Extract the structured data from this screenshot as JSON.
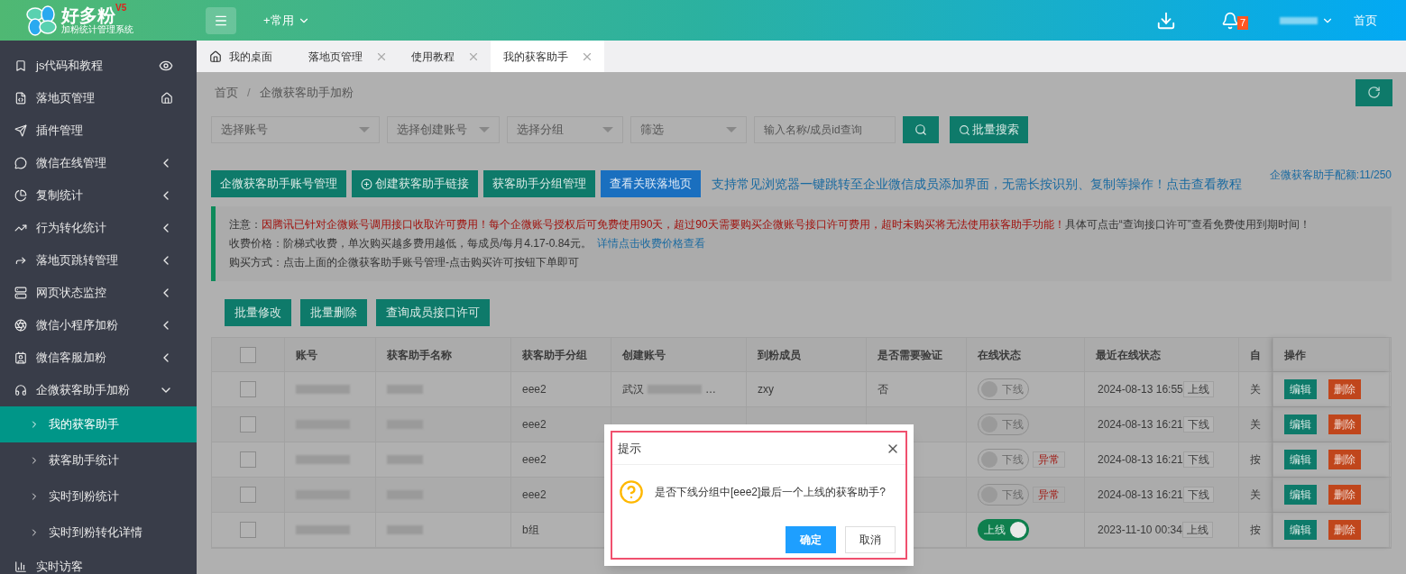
{
  "header": {
    "logo": {
      "title": "好多粉",
      "version": "V5",
      "subtitle": "加粉统计管理系统"
    },
    "quick_menu": "+常用",
    "notification_count": "7",
    "home_link": "首页"
  },
  "sidebar": {
    "items": [
      {
        "label": "js代码和教程",
        "kind": "link",
        "selected": false
      },
      {
        "label": "落地页管理",
        "kind": "link",
        "selected": false
      },
      {
        "label": "插件管理",
        "kind": "link",
        "selected": false
      },
      {
        "label": "微信在线管理",
        "kind": "group",
        "expanded": false,
        "selected": false
      },
      {
        "label": "复制统计",
        "kind": "group",
        "expanded": false,
        "selected": false
      },
      {
        "label": "行为转化统计",
        "kind": "group",
        "expanded": false,
        "selected": false
      },
      {
        "label": "落地页跳转管理",
        "kind": "group",
        "expanded": false,
        "selected": false
      },
      {
        "label": "网页状态监控",
        "kind": "group",
        "expanded": false,
        "selected": false
      },
      {
        "label": "微信小程序加粉",
        "kind": "group",
        "expanded": false,
        "selected": false
      },
      {
        "label": "微信客服加粉",
        "kind": "group",
        "expanded": false,
        "selected": false
      },
      {
        "label": "企微获客助手加粉",
        "kind": "group",
        "expanded": true,
        "selected": false,
        "children": [
          {
            "label": "我的获客助手",
            "selected": true
          },
          {
            "label": "获客助手统计",
            "selected": false
          },
          {
            "label": "实时到粉统计",
            "selected": false
          },
          {
            "label": "实时到粉转化详情",
            "selected": false
          }
        ]
      },
      {
        "label": "实时访客",
        "kind": "link",
        "selected": false
      }
    ]
  },
  "tabs": [
    {
      "label": "我的桌面",
      "kind": "home",
      "selected": false
    },
    {
      "label": "落地页管理",
      "kind": "closable",
      "selected": false
    },
    {
      "label": "使用教程",
      "kind": "closable",
      "selected": false
    },
    {
      "label": "我的获客助手",
      "kind": "closable",
      "selected": true
    }
  ],
  "breadcrumb": {
    "items": [
      "首页",
      "企微获客助手加粉"
    ],
    "separator": "/"
  },
  "filters": {
    "selects": [
      {
        "placeholder": "选择账号"
      },
      {
        "placeholder": "选择创建账号"
      },
      {
        "placeholder": "选择分组"
      },
      {
        "placeholder": "筛选"
      }
    ],
    "search": {
      "placeholder": "输入名称/成员id查询"
    },
    "batch_search": "批量搜索"
  },
  "actions": [
    {
      "label": "企微获客助手账号管理",
      "kind": "primary"
    },
    {
      "label": "创建获客助手链接",
      "kind": "create"
    },
    {
      "label": "获客助手分组管理",
      "kind": "primary"
    },
    {
      "label": "查看关联落地页",
      "kind": "info"
    }
  ],
  "tip_link": "支持常见浏览器一键跳转至企业微信成员添加界面，无需长按识别、复制等操作！点击查看教程",
  "quota": "企微获客助手配额:11/250",
  "notice": [
    {
      "label": "注意：",
      "warning": "因腾讯已针对企微账号调用接口收取许可费用！每个企微账号授权后可免费使用90天，超过90天需要购买企微账号接口许可费用，超时未购买将无法使用获客助手功能！",
      "text": "具体可点击“查询接口许可”查看免费使用到期时间！"
    },
    {
      "label": "收费价格：",
      "text": "阶梯式收费，单次购买越多费用越低，每成员/每月4.17-0.84元。",
      "link": "详情点击收费价格查看"
    },
    {
      "label": "购买方式：",
      "text": "点击上面的企微获客助手账号管理-点击购买许可按钮下单即可"
    }
  ],
  "table_actions": [
    "批量修改",
    "批量删除",
    "查询成员接口许可"
  ],
  "table": {
    "select_all_checked": false,
    "columns": [
      "账号",
      "获客助手名称",
      "获客助手分组",
      "创建账号",
      "到粉成员",
      "是否需要验证",
      "在线状态",
      "最近在线状态",
      "自",
      "操作"
    ],
    "rows": [
      {
        "checked": false,
        "group": "eee2",
        "creator": "武汉",
        "creator_suffix": "…",
        "member": "zxy",
        "verify": "否",
        "online": false,
        "online_label": "下线",
        "abnormal": null,
        "last_time": "2024-08-13 16:55",
        "last_status": "上线",
        "auto": "关",
        "edit": "编辑",
        "delete": "删除"
      },
      {
        "checked": false,
        "group": "eee2",
        "online": false,
        "online_label": "下线",
        "abnormal": null,
        "last_time": "2024-08-13 16:21",
        "last_status": "下线",
        "auto": "关",
        "edit": "编辑",
        "delete": "删除"
      },
      {
        "checked": false,
        "group": "eee2",
        "online": false,
        "online_label": "下线",
        "abnormal": "异常",
        "last_time": "2024-08-13 16:21",
        "last_status": "下线",
        "auto": "按",
        "edit": "编辑",
        "delete": "删除"
      },
      {
        "checked": false,
        "group": "eee2",
        "online": false,
        "online_label": "下线",
        "abnormal": "异常",
        "last_time": "2024-08-13 16:21",
        "last_status": "下线",
        "auto": "关",
        "edit": "编辑",
        "delete": "删除"
      },
      {
        "checked": false,
        "group": "b组",
        "online": true,
        "online_label": "上线",
        "abnormal": null,
        "last_time": "2023-11-10 00:34",
        "last_status": "上线",
        "auto": "按",
        "edit": "编辑",
        "delete": "删除"
      }
    ]
  },
  "dialog": {
    "title": "提示",
    "message": "是否下线分组中[eee2]最后一个上线的获客助手?",
    "confirm": "确定",
    "cancel": "取消"
  }
}
